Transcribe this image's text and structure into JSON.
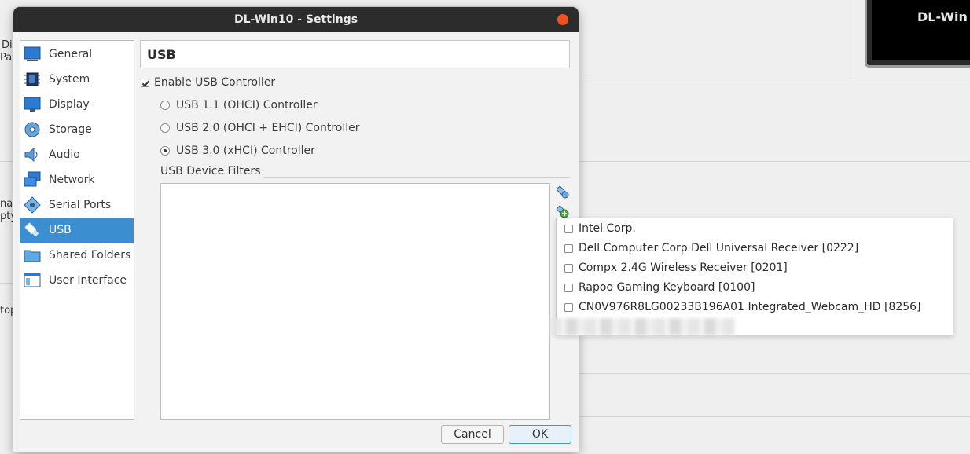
{
  "window": {
    "title": "DL-Win10 - Settings"
  },
  "background": {
    "preview_text": "DL-Win",
    "fragments": [
      "Di",
      "Pa",
      "na",
      "pty",
      "top"
    ]
  },
  "sidebar": {
    "items": [
      {
        "label": "General",
        "icon": "general-icon"
      },
      {
        "label": "System",
        "icon": "system-chip-icon"
      },
      {
        "label": "Display",
        "icon": "display-monitor-icon"
      },
      {
        "label": "Storage",
        "icon": "storage-disc-icon"
      },
      {
        "label": "Audio",
        "icon": "audio-speaker-icon"
      },
      {
        "label": "Network",
        "icon": "network-icon"
      },
      {
        "label": "Serial Ports",
        "icon": "serial-port-icon"
      },
      {
        "label": "USB",
        "icon": "usb-icon",
        "selected": true
      },
      {
        "label": "Shared Folders",
        "icon": "shared-folder-icon"
      },
      {
        "label": "User Interface",
        "icon": "user-interface-icon"
      }
    ]
  },
  "page": {
    "header": "USB",
    "enable_usb": {
      "label": "Enable USB Controller",
      "checked": true
    },
    "controllers": [
      {
        "label": "USB 1.1 (OHCI) Controller",
        "selected": false
      },
      {
        "label": "USB 2.0 (OHCI + EHCI) Controller",
        "selected": false
      },
      {
        "label": "USB 3.0 (xHCI) Controller",
        "selected": true
      }
    ],
    "filters_label": "USB Device Filters"
  },
  "popup": {
    "items": [
      "Intel Corp.",
      "Dell Computer Corp Dell Universal Receiver [0222]",
      "Compx 2.4G Wireless Receiver [0201]",
      "Rapoo Gaming Keyboard [0100]",
      "CN0V976R8LG00233B196A01 Integrated_Webcam_HD [8256]"
    ]
  },
  "buttons": {
    "cancel": "Cancel",
    "ok": "OK"
  },
  "colors": {
    "selection": "#3b8ed0",
    "titlebar": "#2c2c2c",
    "close": "#e95420"
  }
}
